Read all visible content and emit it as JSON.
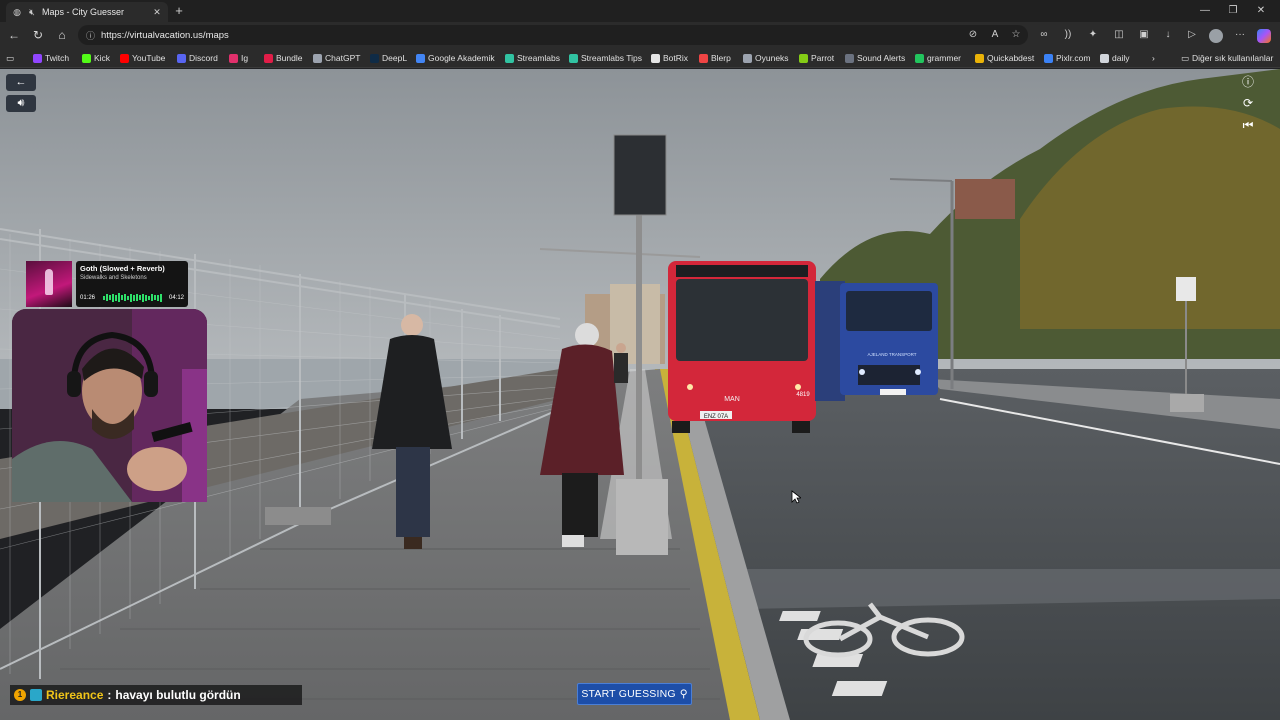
{
  "browser": {
    "tab": {
      "title": "Maps - City Guesser"
    },
    "address": {
      "url": "https://virtualvacation.us/maps"
    },
    "bookmarks": [
      {
        "label": "Twitch",
        "color": "#9146ff"
      },
      {
        "label": "Kick",
        "color": "#53fc18"
      },
      {
        "label": "YouTube",
        "color": "#ff0000"
      },
      {
        "label": "Discord",
        "color": "#5865f2"
      },
      {
        "label": "Ig",
        "color": "#e1306c"
      },
      {
        "label": "Bundle",
        "color": "#e11d48"
      },
      {
        "label": "ChatGPT",
        "color": "#9ca3af"
      },
      {
        "label": "DeepL",
        "color": "#0f2b46"
      },
      {
        "label": "Google Akademik",
        "color": "#4285f4"
      },
      {
        "label": "Streamlabs",
        "color": "#31c3a2"
      },
      {
        "label": "Streamlabs Tips",
        "color": "#31c3a2"
      },
      {
        "label": "BotRix",
        "color": "#e5e5e5"
      },
      {
        "label": "Blerp",
        "color": "#ef4444"
      },
      {
        "label": "Oyuneks",
        "color": "#9ca3af"
      },
      {
        "label": "Parrot",
        "color": "#84cc16"
      },
      {
        "label": "Sound Alerts",
        "color": "#6b7280"
      },
      {
        "label": "grammer",
        "color": "#22c55e"
      },
      {
        "label": "Quickabdest",
        "color": "#eab308"
      },
      {
        "label": "Pixlr.com",
        "color": "#3b82f6"
      },
      {
        "label": "daily",
        "color": "#d1d5db"
      }
    ],
    "other_bookmarks": "Diğer sık kullanılanlar"
  },
  "game": {
    "start_button": "START GUESSING"
  },
  "music": {
    "song": "Goth (Slowed + Reverb)",
    "artist": "Sidewalks and Skeletons",
    "elapsed": "01:26",
    "total": "04:12"
  },
  "chat": {
    "badge": "1",
    "user": "Riereance",
    "separator": ":",
    "message": "havayı bulutlu gördün"
  },
  "scene": {
    "bus_number": "4819",
    "bus_plate": "ENZ 07A",
    "bus_brand": "MAN",
    "truck_label": "AJELAND TRANSPORT"
  }
}
